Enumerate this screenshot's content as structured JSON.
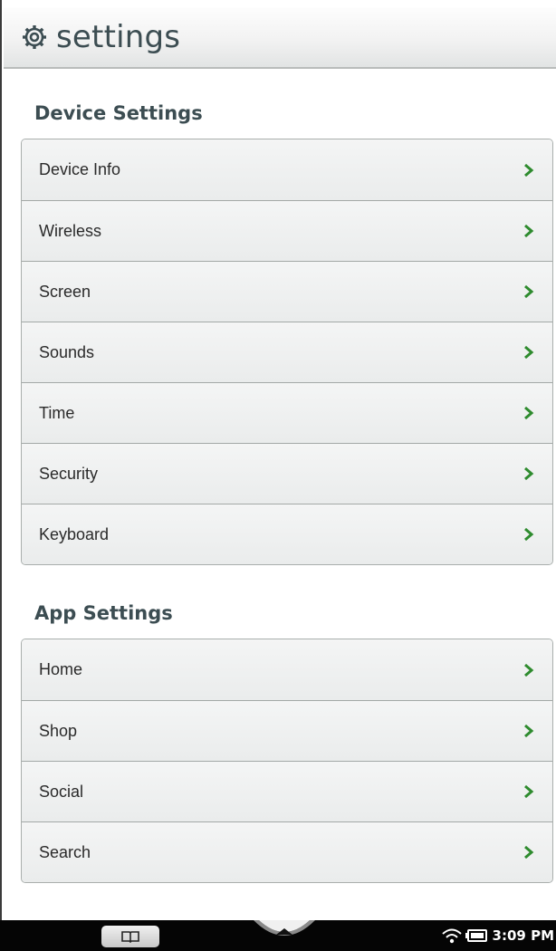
{
  "header": {
    "title": "settings",
    "icon": "gear-icon"
  },
  "device_settings": {
    "heading": "Device Settings",
    "items": [
      {
        "label": "Device Info"
      },
      {
        "label": "Wireless"
      },
      {
        "label": "Screen"
      },
      {
        "label": "Sounds"
      },
      {
        "label": "Time"
      },
      {
        "label": "Security"
      },
      {
        "label": "Keyboard"
      }
    ]
  },
  "app_settings": {
    "heading": "App Settings",
    "items": [
      {
        "label": "Home"
      },
      {
        "label": "Shop"
      },
      {
        "label": "Social"
      },
      {
        "label": "Search"
      }
    ]
  },
  "status_bar": {
    "time": "3:09 PM",
    "icons": [
      "book-icon",
      "up-arrow-icon",
      "wifi-icon",
      "battery-icon"
    ]
  },
  "colors": {
    "chevron": "#2e8b2e",
    "heading": "#3c4d52",
    "nav_bg": "#050505"
  }
}
